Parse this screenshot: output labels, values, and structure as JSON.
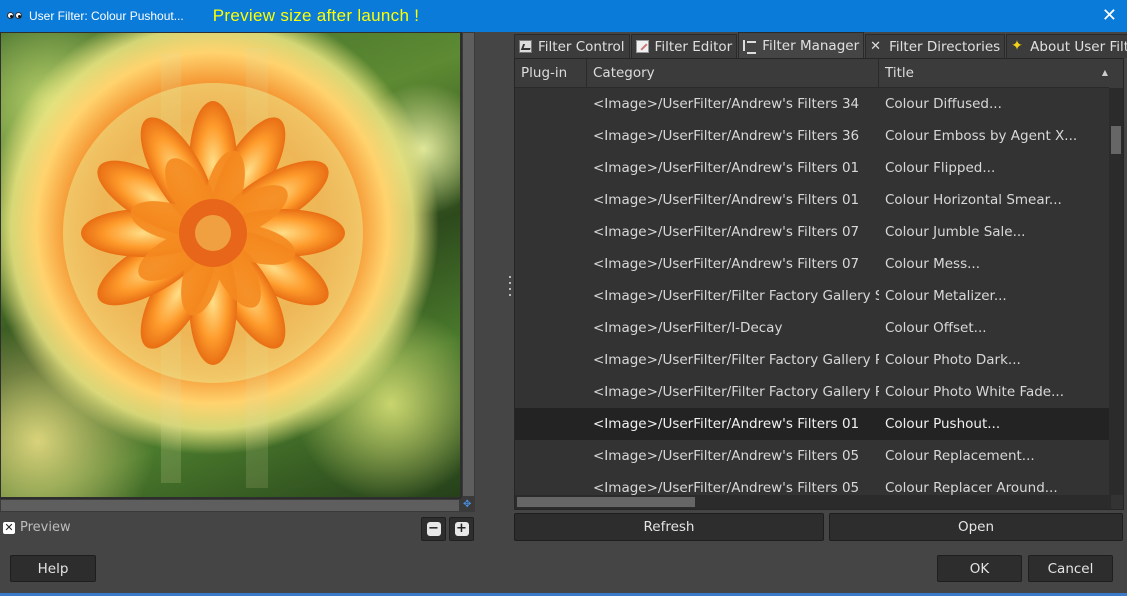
{
  "window": {
    "title": "User Filter: Colour Pushout...",
    "banner": "Preview size after launch !",
    "close_glyph": "✕"
  },
  "preview": {
    "label": "Preview",
    "checkbox_glyph": "✕",
    "zoom_out_glyph": "−",
    "zoom_in_glyph": "+"
  },
  "tabs": [
    {
      "label": "Filter Control",
      "icon": "filter-control-icon"
    },
    {
      "label": "Filter Editor",
      "icon": "filter-editor-icon"
    },
    {
      "label": "Filter Manager",
      "icon": "filter-manager-icon",
      "active": true
    },
    {
      "label": "Filter Directories",
      "icon": "filter-directories-icon"
    },
    {
      "label": "About User Filter",
      "icon": "about-star-icon"
    }
  ],
  "table": {
    "columns": [
      "Plug-in",
      "Category",
      "Title"
    ],
    "sort_glyph": "▲",
    "rows": [
      {
        "plugin": "",
        "category": "<Image>/UserFilter/Andrew's Filters 34",
        "title": "Colour Diffused..."
      },
      {
        "plugin": "",
        "category": "<Image>/UserFilter/Andrew's Filters 36",
        "title": "Colour Emboss by Agent X..."
      },
      {
        "plugin": "",
        "category": "<Image>/UserFilter/Andrew's Filters 01",
        "title": "Colour Flipped..."
      },
      {
        "plugin": "",
        "category": "<Image>/UserFilter/Andrew's Filters 01",
        "title": "Colour Horizontal Smear..."
      },
      {
        "plugin": "",
        "category": "<Image>/UserFilter/Andrew's Filters 07",
        "title": "Colour Jumble Sale..."
      },
      {
        "plugin": "",
        "category": "<Image>/UserFilter/Andrew's Filters 07",
        "title": "Colour Mess..."
      },
      {
        "plugin": "",
        "category": "<Image>/UserFilter/Filter Factory Gallery S",
        "title": "Colour Metalizer..."
      },
      {
        "plugin": "",
        "category": "<Image>/UserFilter/I-Decay",
        "title": "Colour Offset..."
      },
      {
        "plugin": "",
        "category": "<Image>/UserFilter/Filter Factory Gallery R",
        "title": "Colour Photo Dark..."
      },
      {
        "plugin": "",
        "category": "<Image>/UserFilter/Filter Factory Gallery R",
        "title": "Colour Photo White Fade..."
      },
      {
        "plugin": "",
        "category": "<Image>/UserFilter/Andrew's Filters 01",
        "title": "Colour Pushout...",
        "selected": true
      },
      {
        "plugin": "",
        "category": "<Image>/UserFilter/Andrew's Filters 05",
        "title": "Colour Replacement..."
      },
      {
        "plugin": "",
        "category": "<Image>/UserFilter/Andrew's Filters 05",
        "title": "Colour Replacer Around..."
      }
    ]
  },
  "buttons": {
    "refresh": "Refresh",
    "open": "Open",
    "help": "Help",
    "ok": "OK",
    "cancel": "Cancel"
  },
  "colors": {
    "titlebar": "#0a7bd8",
    "banner_text": "#ffff00",
    "dialog_bg": "#454545",
    "selected_row": "#232323"
  }
}
